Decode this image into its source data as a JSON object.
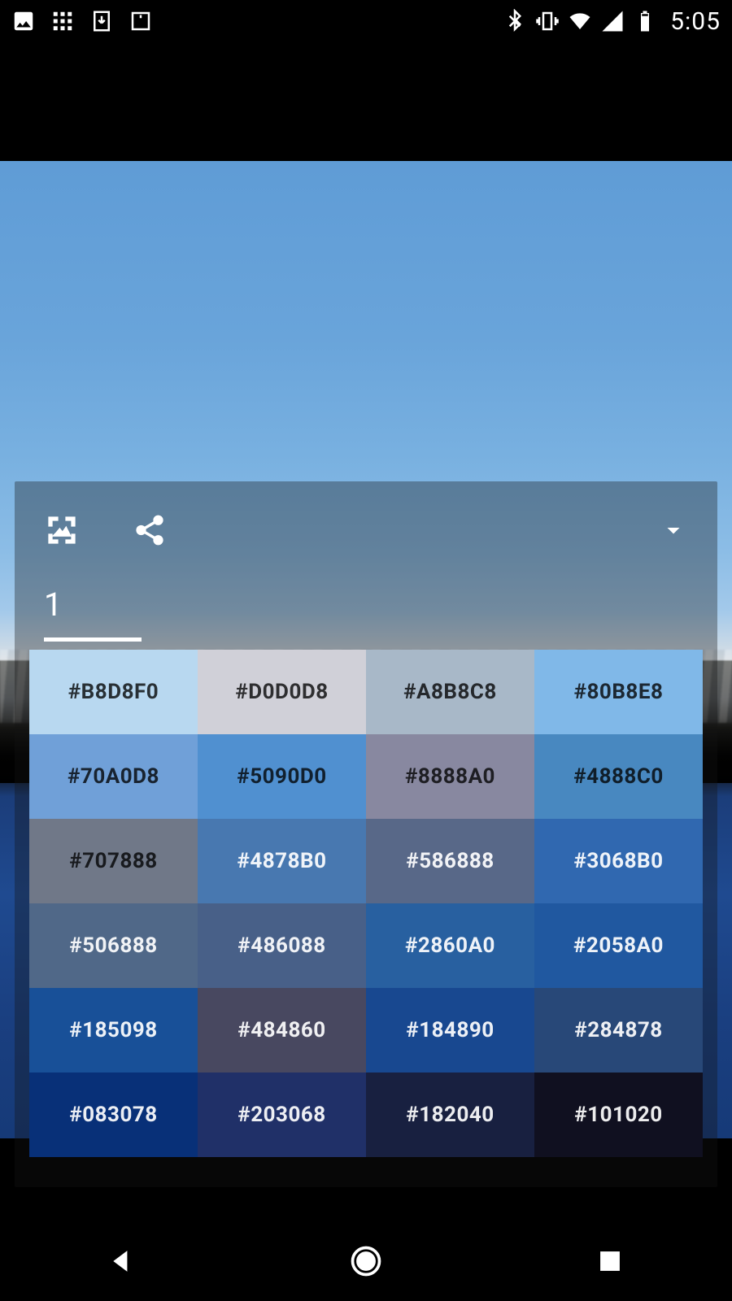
{
  "status": {
    "clock": "5:05"
  },
  "sheet": {
    "tab_label": "1"
  },
  "palette": [
    {
      "hex": "#B8D8F0",
      "light": false
    },
    {
      "hex": "#D0D0D8",
      "light": false
    },
    {
      "hex": "#A8B8C8",
      "light": false
    },
    {
      "hex": "#80B8E8",
      "light": false
    },
    {
      "hex": "#70A0D8",
      "light": false
    },
    {
      "hex": "#5090D0",
      "light": false
    },
    {
      "hex": "#8888A0",
      "light": false
    },
    {
      "hex": "#4888C0",
      "light": false
    },
    {
      "hex": "#707888",
      "light": false
    },
    {
      "hex": "#4878B0",
      "light": true
    },
    {
      "hex": "#586888",
      "light": true
    },
    {
      "hex": "#3068B0",
      "light": true
    },
    {
      "hex": "#506888",
      "light": true
    },
    {
      "hex": "#486088",
      "light": true
    },
    {
      "hex": "#2860A0",
      "light": true
    },
    {
      "hex": "#2058A0",
      "light": true
    },
    {
      "hex": "#185098",
      "light": true
    },
    {
      "hex": "#484860",
      "light": true
    },
    {
      "hex": "#184890",
      "light": true
    },
    {
      "hex": "#284878",
      "light": true
    },
    {
      "hex": "#083078",
      "light": true
    },
    {
      "hex": "#203068",
      "light": true
    },
    {
      "hex": "#182040",
      "light": true
    },
    {
      "hex": "#101020",
      "light": true
    }
  ]
}
